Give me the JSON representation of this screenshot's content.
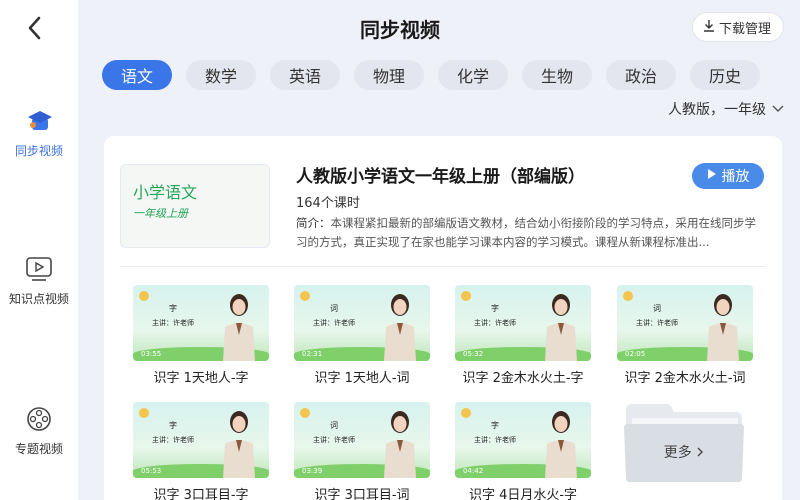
{
  "header": {
    "title": "同步视频",
    "download_label": "下载管理"
  },
  "sidebar": {
    "items": [
      {
        "label": "同步视频",
        "icon": "graduation-cap-icon",
        "active": true
      },
      {
        "label": "知识点视频",
        "icon": "play-screen-icon",
        "active": false
      },
      {
        "label": "专题视频",
        "icon": "film-reel-icon",
        "active": false
      }
    ]
  },
  "tabs": [
    {
      "label": "语文",
      "active": true
    },
    {
      "label": "数学"
    },
    {
      "label": "英语"
    },
    {
      "label": "物理"
    },
    {
      "label": "化学"
    },
    {
      "label": "生物"
    },
    {
      "label": "政治"
    },
    {
      "label": "历史"
    }
  ],
  "edition": "人教版，一年级",
  "course": {
    "cover_title": "小学语文",
    "cover_subtitle": "一年级上册",
    "title": "人教版小学语文一年级上册（部编版）",
    "count": "164个课时",
    "desc_label": "简介：",
    "description": "本课程紧扣最新的部编版语文教材，结合幼小衔接阶段的学习特点，采用在线同步学习的方式，真正实现了在家也能学习课本内容的学习模式。课程从新课程标准出...",
    "play_label": "播放"
  },
  "videos": [
    {
      "word": "字",
      "teacher": "主讲：许老师",
      "duration": "03:55",
      "title": "识字 1天地人-字"
    },
    {
      "word": "词",
      "teacher": "主讲：许老师",
      "duration": "02:31",
      "title": "识字 1天地人-词"
    },
    {
      "word": "字",
      "teacher": "主讲：许老师",
      "duration": "05:32",
      "title": "识字 2金木水火土-字"
    },
    {
      "word": "词",
      "teacher": "主讲：许老师",
      "duration": "02:05",
      "title": "识字 2金木水火土-词"
    },
    {
      "word": "字",
      "teacher": "主讲：许老师",
      "duration": "05:53",
      "title": "识字 3口耳目-字"
    },
    {
      "word": "词",
      "teacher": "主讲：许老师",
      "duration": "03:39",
      "title": "识字 3口耳目-词"
    },
    {
      "word": "字",
      "teacher": "主讲：许老师",
      "duration": "04:42",
      "title": "识字 4日月水火-字"
    }
  ],
  "more_label": "更多",
  "colors": {
    "accent": "#3b76e8",
    "play": "#4a8ae8",
    "cover_green": "#23a55a"
  }
}
